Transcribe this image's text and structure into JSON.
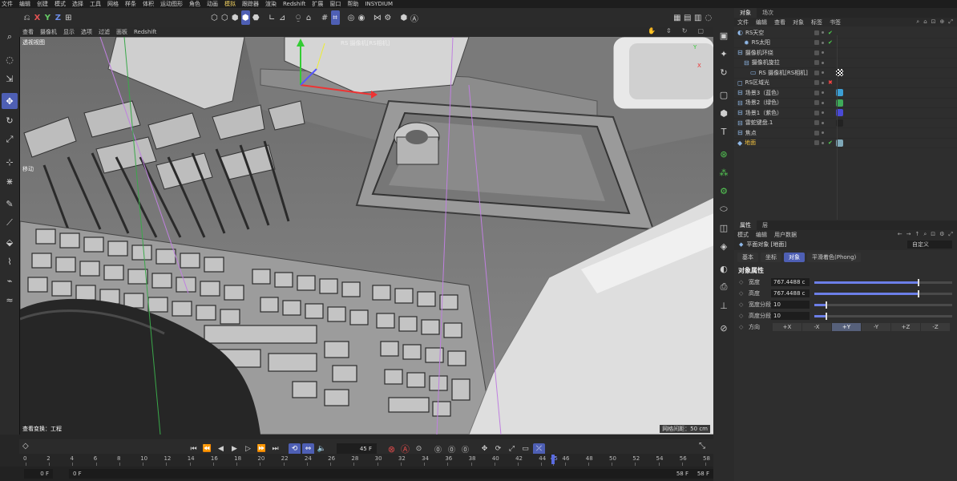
{
  "menubar": [
    "文件",
    "编辑",
    "创建",
    "模式",
    "选择",
    "工具",
    "网格",
    "样条",
    "体积",
    "运动图形",
    "角色",
    "动画",
    "模拟",
    "跟踪器",
    "渲染",
    "Redshift",
    "扩展",
    "窗口",
    "帮助",
    "INSYDIUM"
  ],
  "toolbar": {
    "x": "X",
    "y": "Y",
    "z": "Z"
  },
  "viewport": {
    "menu": [
      "查看",
      "摄像机",
      "显示",
      "选项",
      "过滤",
      "面板",
      "Redshift"
    ],
    "label": "透视视图",
    "camera_label": "RS 摄像机[RS相机] ",
    "move_label": "移动",
    "info": "查看变换：工程",
    "grid": "网格间距：50 cm"
  },
  "timeline": {
    "frame": "45 F",
    "ruler": [
      "0",
      "2",
      "4",
      "6",
      "8",
      "10",
      "12",
      "14",
      "16",
      "18",
      "20",
      "22",
      "24",
      "26",
      "28",
      "30",
      "32",
      "34",
      "36",
      "38",
      "40",
      "42",
      "44",
      "45",
      "46",
      "48",
      "50",
      "52",
      "54",
      "56",
      "58"
    ],
    "current": 45
  },
  "bottombar": {
    "start": "0 F",
    "min": "0 F",
    "max": "58 F",
    "end": "58 F"
  },
  "objmgr": {
    "tabs": [
      "对象",
      "场次"
    ],
    "menu": [
      "文件",
      "编辑",
      "查看",
      "对象",
      "标签",
      "书签"
    ],
    "objects": [
      {
        "name": "RS天空",
        "indent": 0,
        "icon": "◐",
        "check": true
      },
      {
        "name": "RS太阳",
        "indent": 1,
        "icon": "✹",
        "check": true
      },
      {
        "name": "摄像机环绕",
        "indent": 0,
        "icon": "⊟",
        "check": false
      },
      {
        "name": "摄像机旋拉",
        "indent": 1,
        "icon": "⊟",
        "check": false
      },
      {
        "name": "RS 摄像机[RS相机]",
        "indent": 2,
        "icon": "▭",
        "check": false,
        "tag": "checker"
      },
      {
        "name": "RS区域光",
        "indent": 0,
        "icon": "◻",
        "check": false,
        "cross": true
      },
      {
        "name": "场景3（蓝色）",
        "indent": 0,
        "icon": "⊟",
        "check": false,
        "tag": "#3c9ed4"
      },
      {
        "name": "场景2（绿色）",
        "indent": 0,
        "icon": "⊟",
        "check": false,
        "tag": "#3faa5a"
      },
      {
        "name": "场景1（紫色）",
        "indent": 0,
        "icon": "⊟",
        "check": false,
        "tag": "#4a4ad6"
      },
      {
        "name": "雷蛇键盘.1",
        "indent": 0,
        "icon": "⊟",
        "check": false,
        "tag": "#222222"
      },
      {
        "name": "焦点",
        "indent": 0,
        "icon": "⊟",
        "check": false
      },
      {
        "name": "地面",
        "indent": 0,
        "icon": "◆",
        "check": true,
        "selected": true,
        "tag": "#7fa8b8"
      }
    ]
  },
  "attrmgr": {
    "tabs": [
      "属性",
      "层"
    ],
    "menu": [
      "模式",
      "编辑",
      "用户数据"
    ],
    "title": "平面对象 [地面]",
    "custom": "自定义",
    "subtabs": [
      "基本",
      "坐标",
      "对象",
      "平滑着色(Phong)"
    ],
    "section": "对象属性",
    "rows": [
      {
        "label": "宽度",
        "value": "767.4488 c",
        "slider": 0.75
      },
      {
        "label": "高度",
        "value": "767.4488 c",
        "slider": 0.75
      },
      {
        "label": "宽度分段",
        "value": "10",
        "slider": 0.08
      },
      {
        "label": "高度分段",
        "value": "10",
        "slider": 0.08
      }
    ],
    "direction_label": "方向",
    "directions": [
      "+X",
      "-X",
      "+Y",
      "-Y",
      "+Z",
      "-Z"
    ],
    "direction_selected": "+Y"
  }
}
